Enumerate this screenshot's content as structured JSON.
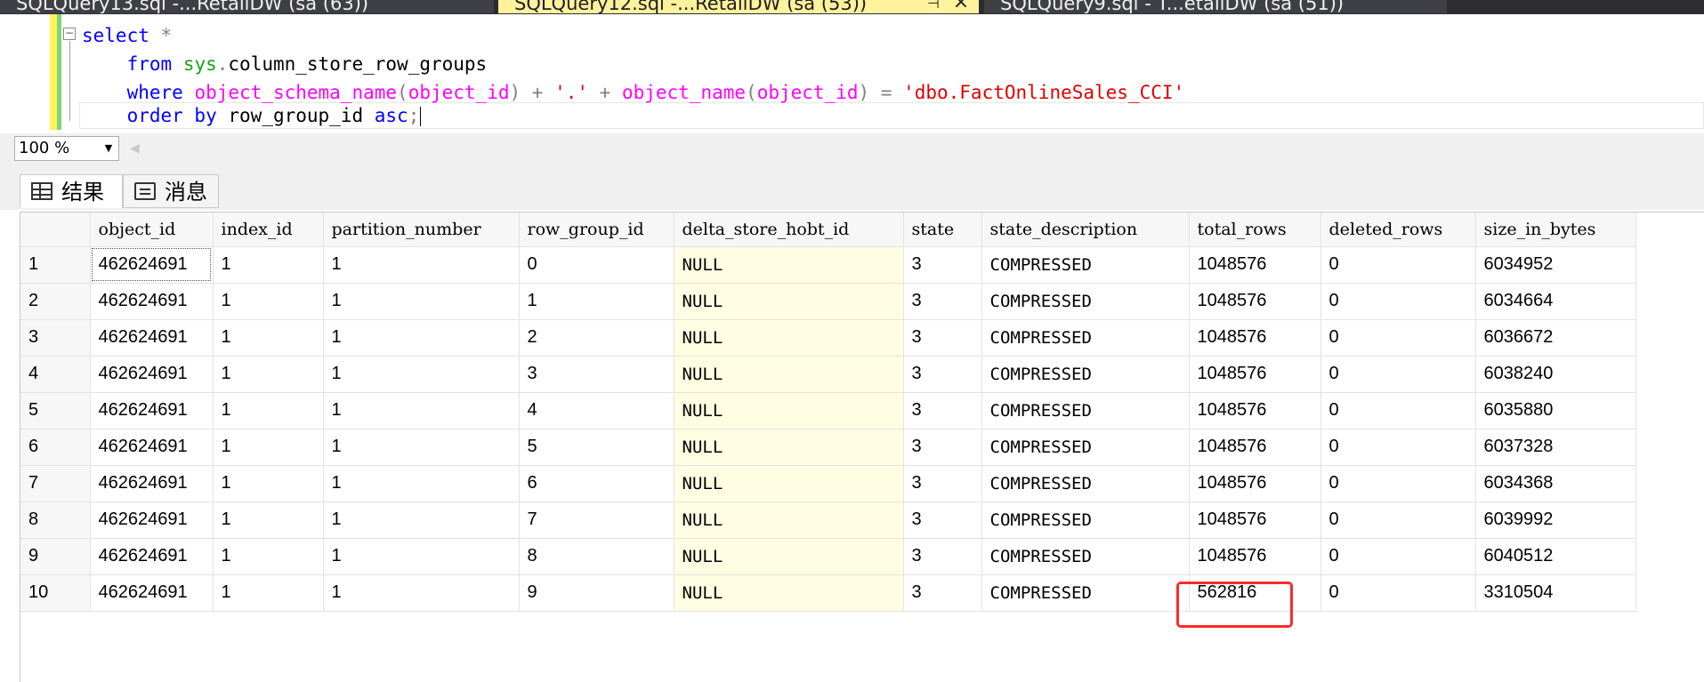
{
  "tabs": [
    {
      "label": "SQLQuery13.sql -...RetailDW (sa (63))",
      "active": false
    },
    {
      "label": "SQLQuery12.sql -...RetailDW (sa (53))",
      "active": true
    },
    {
      "label": "SQLQuery9.sql - T...etailDW (sa (51))",
      "active": false
    }
  ],
  "editor": {
    "line1": {
      "select": "select",
      "star": " *"
    },
    "line2": {
      "from": "from",
      "sys": "sys",
      "dot": ".",
      "table": "column_store_row_groups"
    },
    "line3": {
      "where": "where",
      "fn1": "object_schema_name",
      "arg1_open": "(",
      "arg1": "object_id",
      "arg1_close": ")",
      "plus1": " + ",
      "dot_str": "'.'",
      "plus2": " + ",
      "fn2": "object_name",
      "arg2_open": "(",
      "arg2": "object_id",
      "arg2_close": ")",
      "eq": " = ",
      "value": "'dbo.FactOnlineSales_CCI'"
    },
    "line4": {
      "order_by": "order by",
      "column": "row_group_id",
      "asc": "asc",
      "semicolon": ";"
    }
  },
  "zoom": {
    "value": "100 %"
  },
  "result_tabs": [
    {
      "label": "结果",
      "icon": "grid-icon",
      "active": true
    },
    {
      "label": "消息",
      "icon": "message-icon",
      "active": false
    }
  ],
  "grid": {
    "columns": [
      "object_id",
      "index_id",
      "partition_number",
      "row_group_id",
      "delta_store_hobt_id",
      "state",
      "state_description",
      "total_rows",
      "deleted_rows",
      "size_in_bytes"
    ],
    "rows": [
      [
        "1",
        "462624691",
        "1",
        "1",
        "0",
        "NULL",
        "3",
        "COMPRESSED",
        "1048576",
        "0",
        "6034952"
      ],
      [
        "2",
        "462624691",
        "1",
        "1",
        "1",
        "NULL",
        "3",
        "COMPRESSED",
        "1048576",
        "0",
        "6034664"
      ],
      [
        "3",
        "462624691",
        "1",
        "1",
        "2",
        "NULL",
        "3",
        "COMPRESSED",
        "1048576",
        "0",
        "6036672"
      ],
      [
        "4",
        "462624691",
        "1",
        "1",
        "3",
        "NULL",
        "3",
        "COMPRESSED",
        "1048576",
        "0",
        "6038240"
      ],
      [
        "5",
        "462624691",
        "1",
        "1",
        "4",
        "NULL",
        "3",
        "COMPRESSED",
        "1048576",
        "0",
        "6035880"
      ],
      [
        "6",
        "462624691",
        "1",
        "1",
        "5",
        "NULL",
        "3",
        "COMPRESSED",
        "1048576",
        "0",
        "6037328"
      ],
      [
        "7",
        "462624691",
        "1",
        "1",
        "6",
        "NULL",
        "3",
        "COMPRESSED",
        "1048576",
        "0",
        "6034368"
      ],
      [
        "8",
        "462624691",
        "1",
        "1",
        "7",
        "NULL",
        "3",
        "COMPRESSED",
        "1048576",
        "0",
        "6039992"
      ],
      [
        "9",
        "462624691",
        "1",
        "1",
        "8",
        "NULL",
        "3",
        "COMPRESSED",
        "1048576",
        "0",
        "6040512"
      ],
      [
        "10",
        "462624691",
        "1",
        "1",
        "9",
        "NULL",
        "3",
        "COMPRESSED",
        "562816",
        "0",
        "3310504"
      ]
    ]
  },
  "colors": {
    "highlight_box": "#ff2a2a",
    "null_cell_bg": "#fffde2",
    "active_tab_bg": "#fff29d"
  }
}
